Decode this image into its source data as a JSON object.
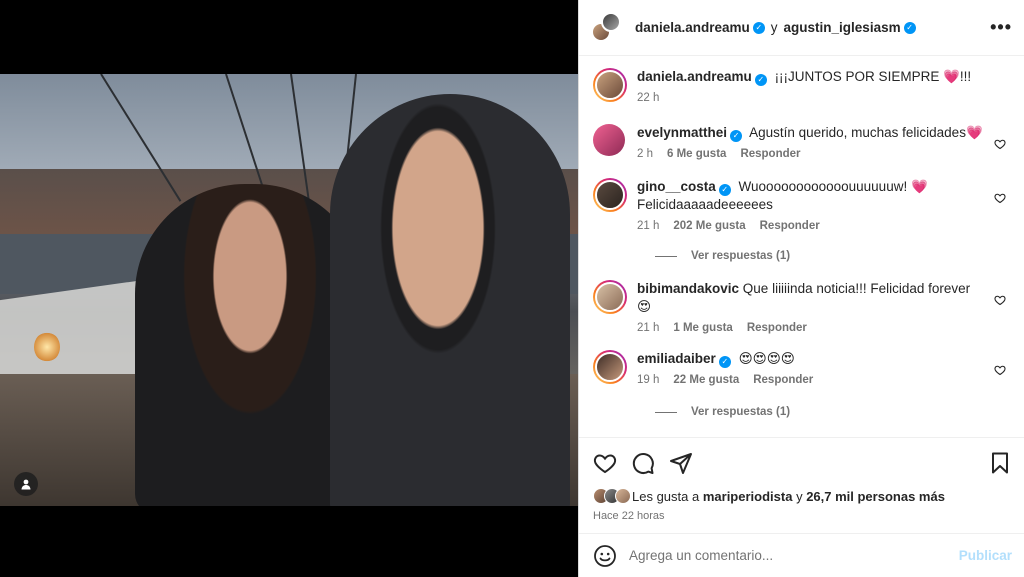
{
  "post": {
    "author": "daniela.andreamu",
    "conjunction": "y",
    "coauthor": "agustin_iglesiasm",
    "more_label": "•••"
  },
  "caption": {
    "username": "daniela.andreamu",
    "text": "¡¡¡JUNTOS POR SIEMPRE 💗!!!",
    "time": "22 h"
  },
  "comments": [
    {
      "username": "evelynmatthei",
      "text": "Agustín querido, muchas felicidades💗",
      "time": "2 h",
      "likes": "6 Me gusta",
      "reply": "Responder",
      "verified": true
    },
    {
      "username": "gino__costa",
      "text": "Wuoooooooooooouuuuuuw! 💗 Felicidaaaaadeeeeees",
      "time": "21 h",
      "likes": "202 Me gusta",
      "reply": "Responder",
      "verified": true,
      "replies": "Ver respuestas (1)"
    },
    {
      "username": "bibimandakovic",
      "text": "Que liiiiinda noticia!!! Felicidad forever 😍",
      "time": "21 h",
      "likes": "1 Me gusta",
      "reply": "Responder",
      "verified": false
    },
    {
      "username": "emiliadaiber",
      "text": "😍😍😍😍",
      "time": "19 h",
      "likes": "22 Me gusta",
      "reply": "Responder",
      "verified": true,
      "replies": "Ver respuestas (1)"
    }
  ],
  "likes_summary": {
    "prefix": "Les gusta a",
    "user": "mariperiodista",
    "middle": "y",
    "others": "26,7 mil personas más"
  },
  "posted_ago": "Hace 22 horas",
  "comment_box": {
    "placeholder": "Agrega un comentario...",
    "publish_label": "Publicar"
  },
  "icons": {
    "like": "heart-icon",
    "comment": "comment-icon",
    "share": "share-icon",
    "save": "bookmark-icon",
    "emoji": "emoji-icon",
    "user_tag": "user-tag-icon"
  },
  "colors": {
    "verified": "#0095f6",
    "publish_disabled": "#b2dffc",
    "muted_text": "#737373"
  }
}
